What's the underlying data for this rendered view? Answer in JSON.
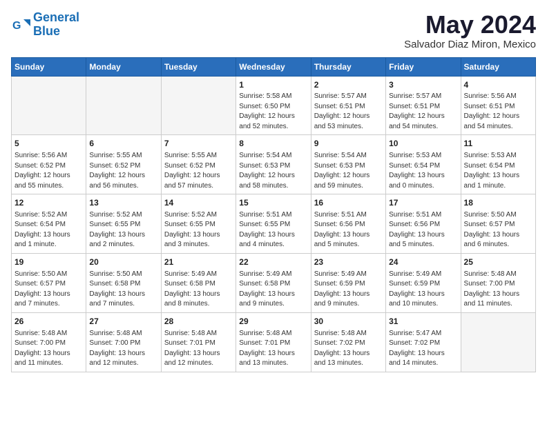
{
  "header": {
    "logo_line1": "General",
    "logo_line2": "Blue",
    "month": "May 2024",
    "location": "Salvador Diaz Miron, Mexico"
  },
  "weekdays": [
    "Sunday",
    "Monday",
    "Tuesday",
    "Wednesday",
    "Thursday",
    "Friday",
    "Saturday"
  ],
  "weeks": [
    [
      {
        "day": "",
        "info": ""
      },
      {
        "day": "",
        "info": ""
      },
      {
        "day": "",
        "info": ""
      },
      {
        "day": "1",
        "info": "Sunrise: 5:58 AM\nSunset: 6:50 PM\nDaylight: 12 hours\nand 52 minutes."
      },
      {
        "day": "2",
        "info": "Sunrise: 5:57 AM\nSunset: 6:51 PM\nDaylight: 12 hours\nand 53 minutes."
      },
      {
        "day": "3",
        "info": "Sunrise: 5:57 AM\nSunset: 6:51 PM\nDaylight: 12 hours\nand 54 minutes."
      },
      {
        "day": "4",
        "info": "Sunrise: 5:56 AM\nSunset: 6:51 PM\nDaylight: 12 hours\nand 54 minutes."
      }
    ],
    [
      {
        "day": "5",
        "info": "Sunrise: 5:56 AM\nSunset: 6:52 PM\nDaylight: 12 hours\nand 55 minutes."
      },
      {
        "day": "6",
        "info": "Sunrise: 5:55 AM\nSunset: 6:52 PM\nDaylight: 12 hours\nand 56 minutes."
      },
      {
        "day": "7",
        "info": "Sunrise: 5:55 AM\nSunset: 6:52 PM\nDaylight: 12 hours\nand 57 minutes."
      },
      {
        "day": "8",
        "info": "Sunrise: 5:54 AM\nSunset: 6:53 PM\nDaylight: 12 hours\nand 58 minutes."
      },
      {
        "day": "9",
        "info": "Sunrise: 5:54 AM\nSunset: 6:53 PM\nDaylight: 12 hours\nand 59 minutes."
      },
      {
        "day": "10",
        "info": "Sunrise: 5:53 AM\nSunset: 6:54 PM\nDaylight: 13 hours\nand 0 minutes."
      },
      {
        "day": "11",
        "info": "Sunrise: 5:53 AM\nSunset: 6:54 PM\nDaylight: 13 hours\nand 1 minute."
      }
    ],
    [
      {
        "day": "12",
        "info": "Sunrise: 5:52 AM\nSunset: 6:54 PM\nDaylight: 13 hours\nand 1 minute."
      },
      {
        "day": "13",
        "info": "Sunrise: 5:52 AM\nSunset: 6:55 PM\nDaylight: 13 hours\nand 2 minutes."
      },
      {
        "day": "14",
        "info": "Sunrise: 5:52 AM\nSunset: 6:55 PM\nDaylight: 13 hours\nand 3 minutes."
      },
      {
        "day": "15",
        "info": "Sunrise: 5:51 AM\nSunset: 6:55 PM\nDaylight: 13 hours\nand 4 minutes."
      },
      {
        "day": "16",
        "info": "Sunrise: 5:51 AM\nSunset: 6:56 PM\nDaylight: 13 hours\nand 5 minutes."
      },
      {
        "day": "17",
        "info": "Sunrise: 5:51 AM\nSunset: 6:56 PM\nDaylight: 13 hours\nand 5 minutes."
      },
      {
        "day": "18",
        "info": "Sunrise: 5:50 AM\nSunset: 6:57 PM\nDaylight: 13 hours\nand 6 minutes."
      }
    ],
    [
      {
        "day": "19",
        "info": "Sunrise: 5:50 AM\nSunset: 6:57 PM\nDaylight: 13 hours\nand 7 minutes."
      },
      {
        "day": "20",
        "info": "Sunrise: 5:50 AM\nSunset: 6:58 PM\nDaylight: 13 hours\nand 7 minutes."
      },
      {
        "day": "21",
        "info": "Sunrise: 5:49 AM\nSunset: 6:58 PM\nDaylight: 13 hours\nand 8 minutes."
      },
      {
        "day": "22",
        "info": "Sunrise: 5:49 AM\nSunset: 6:58 PM\nDaylight: 13 hours\nand 9 minutes."
      },
      {
        "day": "23",
        "info": "Sunrise: 5:49 AM\nSunset: 6:59 PM\nDaylight: 13 hours\nand 9 minutes."
      },
      {
        "day": "24",
        "info": "Sunrise: 5:49 AM\nSunset: 6:59 PM\nDaylight: 13 hours\nand 10 minutes."
      },
      {
        "day": "25",
        "info": "Sunrise: 5:48 AM\nSunset: 7:00 PM\nDaylight: 13 hours\nand 11 minutes."
      }
    ],
    [
      {
        "day": "26",
        "info": "Sunrise: 5:48 AM\nSunset: 7:00 PM\nDaylight: 13 hours\nand 11 minutes."
      },
      {
        "day": "27",
        "info": "Sunrise: 5:48 AM\nSunset: 7:00 PM\nDaylight: 13 hours\nand 12 minutes."
      },
      {
        "day": "28",
        "info": "Sunrise: 5:48 AM\nSunset: 7:01 PM\nDaylight: 13 hours\nand 12 minutes."
      },
      {
        "day": "29",
        "info": "Sunrise: 5:48 AM\nSunset: 7:01 PM\nDaylight: 13 hours\nand 13 minutes."
      },
      {
        "day": "30",
        "info": "Sunrise: 5:48 AM\nSunset: 7:02 PM\nDaylight: 13 hours\nand 13 minutes."
      },
      {
        "day": "31",
        "info": "Sunrise: 5:47 AM\nSunset: 7:02 PM\nDaylight: 13 hours\nand 14 minutes."
      },
      {
        "day": "",
        "info": ""
      }
    ]
  ]
}
